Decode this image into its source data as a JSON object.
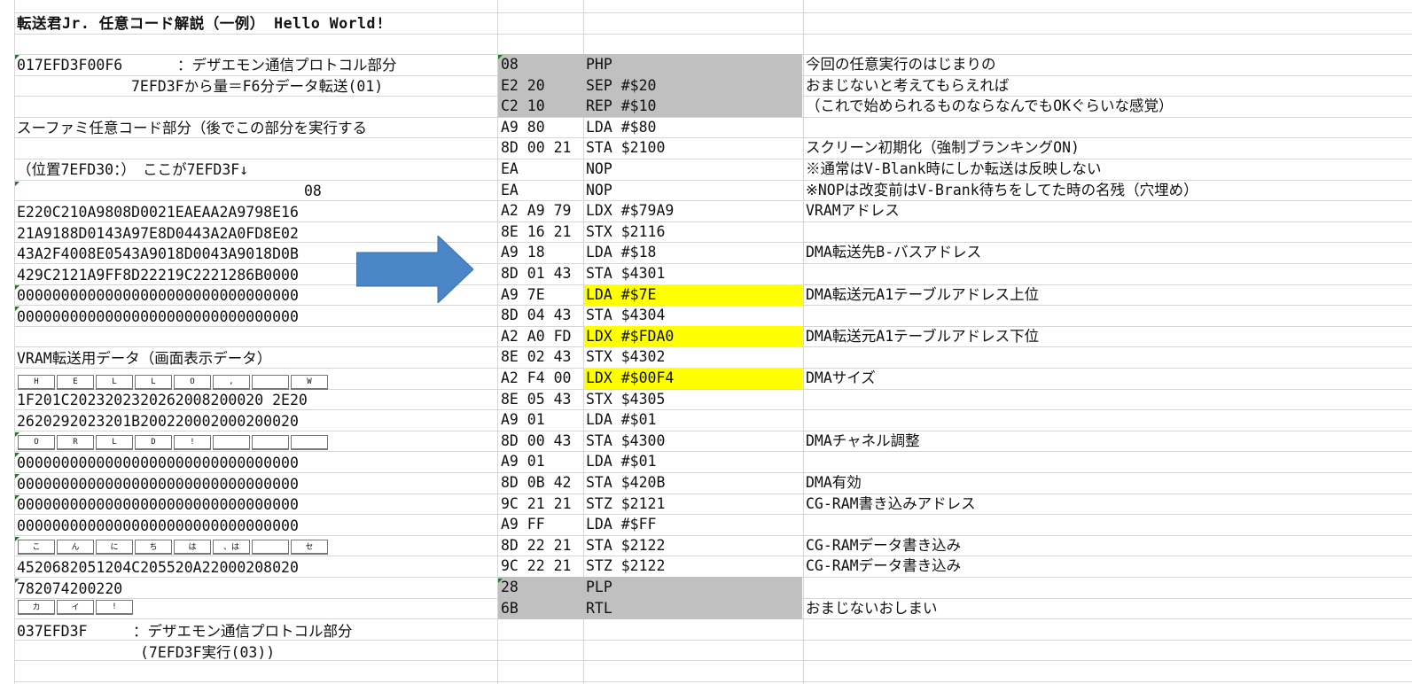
{
  "title": "転送君Jr. 任意コード解説（一例） Hello World!",
  "left": {
    "protocol1_hex": "017EFD3F00F6",
    "protocol1_label": "：デザエモン通信プロトコル部分",
    "protocol1_sub": "7EFD3Fから量＝F6分データ転送(01)",
    "code_heading": "スーファミ任意コード部分（後でこの部分を実行する",
    "position_note": "（位置7EFD30：）　ここが7EFD3F↓",
    "code_08": "08",
    "hex_lines": [
      "E220C210A9808D0021EAEAA2A9798E16",
      "21A9188D0143A97E8D0443A2A0FD8E02",
      "43A2F4008E0543A9018D0043A9018D0B",
      "429C2121A9FF8D22219C2221286B0000",
      "00000000000000000000000000000000",
      "00000000000000000000000000000000"
    ],
    "vram_heading": "VRAM転送用データ（画面表示データ）",
    "keys_hello": [
      "H",
      "E",
      "L",
      "L",
      "O",
      ",",
      "",
      "W"
    ],
    "vram_line1": "1F201C2023202320262008200020 2E20",
    "vram_line2": "2620292023201B200220002000200020",
    "keys_orld": [
      "O",
      "R",
      "L",
      "D",
      "!",
      "",
      "",
      ""
    ],
    "zero_lines": [
      "00000000000000000000000000000000",
      "00000000000000000000000000000000",
      "00000000000000000000000000000000",
      "00000000000000000000000000000000"
    ],
    "keys_konnichiwa": [
      "こ",
      "ん",
      "に",
      "ち",
      "は",
      "、は",
      "",
      "セ"
    ],
    "line_4520": "4520682051204C205520A22000208020",
    "line_7820": "782074200220",
    "keys_kai": [
      "カ",
      "イ",
      "!"
    ],
    "protocol3_hex": "037EFD3F",
    "protocol3_label": "：デザエモン通信プロトコル部分",
    "protocol3_sub": "(7EFD3F実行(03))"
  },
  "asm_rows": [
    {
      "bytes": "08",
      "op": "PHP",
      "comment": "今回の任意実行のはじまりの",
      "gray": true,
      "yellow": false
    },
    {
      "bytes": "E2 20",
      "op": "SEP #$20",
      "comment": "おまじないと考えてもらえれば",
      "gray": true,
      "yellow": false
    },
    {
      "bytes": "C2 10",
      "op": "REP #$10",
      "comment": "（これで始められるものならなんでもOKぐらいな感覚）",
      "gray": true,
      "yellow": false
    },
    {
      "bytes": "A9 80",
      "op": "LDA #$80",
      "comment": "",
      "gray": false,
      "yellow": false
    },
    {
      "bytes": "8D 00 21",
      "op": "STA $2100",
      "comment": "スクリーン初期化（強制ブランキングON)",
      "gray": false,
      "yellow": false
    },
    {
      "bytes": "EA",
      "op": "NOP",
      "comment": "※通常はV-Blank時にしか転送は反映しない",
      "gray": false,
      "yellow": false
    },
    {
      "bytes": "EA",
      "op": "NOP",
      "comment": "※NOPは改変前はV-Brank待ちをしてた時の名残（穴埋め）",
      "gray": false,
      "yellow": false
    },
    {
      "bytes": "A2 A9 79",
      "op": "LDX #$79A9",
      "comment": "VRAMアドレス",
      "gray": false,
      "yellow": false
    },
    {
      "bytes": "8E 16 21",
      "op": "STX $2116",
      "comment": "",
      "gray": false,
      "yellow": false
    },
    {
      "bytes": "A9 18",
      "op": "LDA #$18",
      "comment": "DMA転送先B-バスアドレス",
      "gray": false,
      "yellow": false
    },
    {
      "bytes": "8D 01 43",
      "op": "STA $4301",
      "comment": "",
      "gray": false,
      "yellow": false
    },
    {
      "bytes": "A9 7E",
      "op": "LDA #$7E",
      "comment": "DMA転送元A1テーブルアドレス上位",
      "gray": false,
      "yellow": true
    },
    {
      "bytes": "8D 04 43",
      "op": "STA $4304",
      "comment": "",
      "gray": false,
      "yellow": false
    },
    {
      "bytes": "A2 A0 FD",
      "op": "LDX #$FDA0",
      "comment": "DMA転送元A1テーブルアドレス下位",
      "gray": false,
      "yellow": true
    },
    {
      "bytes": "8E 02 43",
      "op": "STX $4302",
      "comment": "",
      "gray": false,
      "yellow": false
    },
    {
      "bytes": "A2 F4 00",
      "op": "LDX #$00F4",
      "comment": "DMAサイズ",
      "gray": false,
      "yellow": true
    },
    {
      "bytes": "8E 05 43",
      "op": "STX $4305",
      "comment": "",
      "gray": false,
      "yellow": false
    },
    {
      "bytes": "A9 01",
      "op": "LDA #$01",
      "comment": "",
      "gray": false,
      "yellow": false
    },
    {
      "bytes": "8D 00 43",
      "op": "STA $4300",
      "comment": "DMAチャネル調整",
      "gray": false,
      "yellow": false
    },
    {
      "bytes": "A9 01",
      "op": "LDA #$01",
      "comment": "",
      "gray": false,
      "yellow": false
    },
    {
      "bytes": "8D 0B 42",
      "op": "STA $420B",
      "comment": "DMA有効",
      "gray": false,
      "yellow": false
    },
    {
      "bytes": "9C 21 21",
      "op": "STZ $2121",
      "comment": "CG-RAM書き込みアドレス",
      "gray": false,
      "yellow": false
    },
    {
      "bytes": "A9 FF",
      "op": "LDA #$FF",
      "comment": "",
      "gray": false,
      "yellow": false
    },
    {
      "bytes": "8D 22 21",
      "op": "STA $2122",
      "comment": "CG-RAMデータ書き込み",
      "gray": false,
      "yellow": false
    },
    {
      "bytes": "9C 22 21",
      "op": "STZ $2122",
      "comment": "CG-RAMデータ書き込み",
      "gray": false,
      "yellow": false
    },
    {
      "bytes": "28",
      "op": "PLP",
      "comment": "",
      "gray": true,
      "yellow": false
    },
    {
      "bytes": "6B",
      "op": "RTL",
      "comment": "おまじないおしまい",
      "gray": true,
      "yellow": false
    }
  ],
  "colors": {
    "highlight_gray": "#c0c0c0",
    "highlight_yellow": "#ffff00",
    "arrow": "#4a86c8",
    "grid": "#d6d6d6"
  }
}
